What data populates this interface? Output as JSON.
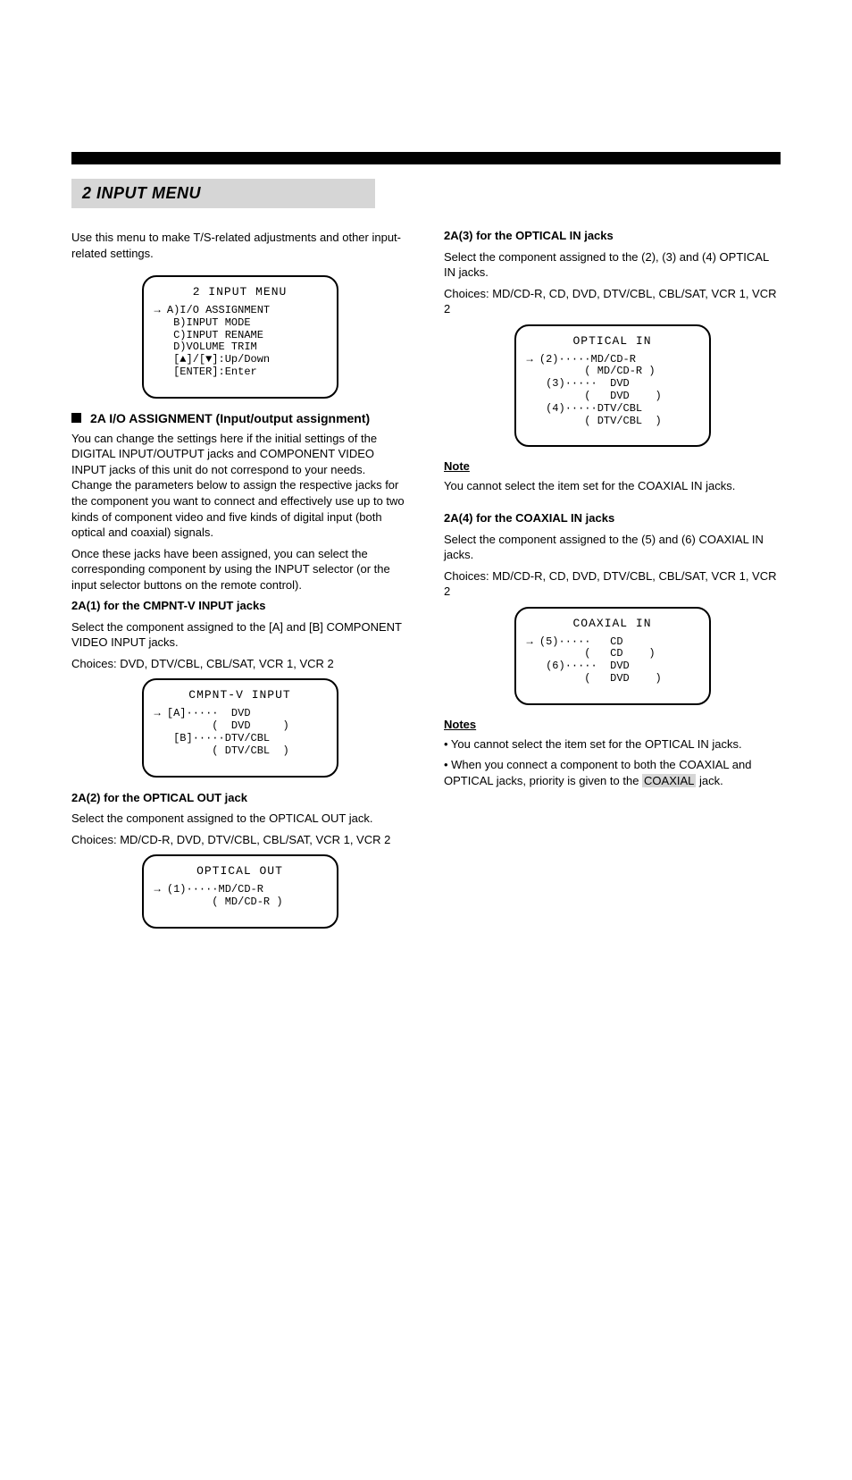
{
  "page": {
    "chapterTop": "",
    "sectionTitle": "2 INPUT MENU",
    "pagerLeft": "",
    "pagerRight": "",
    "leftColumn": {
      "intro": "Use this menu to make T/S-related adjustments and other input-related settings.",
      "osdInputMenu": {
        "title": "2 INPUT MENU",
        "lines": [
          "→ A)I/O ASSIGNMENT",
          "   B)INPUT MODE",
          "   C)INPUT RENAME",
          "   D)VOLUME TRIM",
          "   [▲]/[▼]:Up/Down",
          "   [ENTER]:Enter"
        ]
      },
      "heading1": "2A I/O ASSIGNMENT (Input/output assignment)",
      "p1": "You can change the settings here if the initial settings of the DIGITAL INPUT/OUTPUT jacks and COMPONENT VIDEO INPUT jacks of this unit do not correspond to your needs. Change the parameters below to assign the respective jacks for the component you want to connect and effectively use up to two kinds of component video and five kinds of digital input (both optical and coaxial) signals.",
      "p2": "Once these jacks have been assigned, you can select the corresponding component by using the INPUT selector (or the input selector buttons on the remote control).",
      "sub1": "2A(1) for the CMPNT-V INPUT jacks",
      "sub1desc": "Select the component assigned to the [A] and [B] COMPONENT VIDEO INPUT jacks.",
      "sub1choices": "Choices: DVD, DTV/CBL, CBL/SAT, VCR 1, VCR 2",
      "osdCmpnt": {
        "title": "CMPNT-V INPUT",
        "lines": [
          "→ [A]·····  DVD",
          "         (  DVD     )",
          "   [B]·····DTV/CBL",
          "         ( DTV/CBL  )"
        ]
      },
      "sub2": "2A(2) for the OPTICAL OUT jack",
      "sub2desc": "Select the component assigned to the OPTICAL OUT jack.",
      "sub2choices": "Choices: MD/CD-R, DVD, DTV/CBL, CBL/SAT, VCR 1, VCR 2",
      "osdOptOut": {
        "title": "OPTICAL OUT",
        "lines": [
          "→ (1)·····MD/CD-R",
          "         ( MD/CD-R )"
        ]
      }
    },
    "rightColumn": {
      "sub3": "2A(3) for the OPTICAL IN jacks",
      "sub3desc": "Select the component assigned to the (2), (3) and (4) OPTICAL IN jacks.",
      "sub3choices": "Choices: MD/CD-R, CD, DVD, DTV/CBL, CBL/SAT, VCR 1, VCR 2",
      "osdOptIn": {
        "title": "OPTICAL IN",
        "lines": [
          "→ (2)·····MD/CD-R",
          "         ( MD/CD-R )",
          "   (3)·····  DVD",
          "         (   DVD    )",
          "   (4)·····DTV/CBL",
          "         ( DTV/CBL  )"
        ]
      },
      "note1Label": "Note",
      "note1": "You cannot select the item set for the COAXIAL IN jacks.",
      "sub4": "2A(4) for the COAXIAL IN jacks",
      "sub4desc": "Select the component assigned to the (5) and (6) COAXIAL IN jacks.",
      "sub4choices": "Choices: MD/CD-R, CD, DVD, DTV/CBL, CBL/SAT, VCR 1, VCR 2",
      "osdCoax": {
        "title": "COAXIAL IN",
        "lines": [
          "→ (5)·····   CD",
          "         (   CD    )",
          "   (6)·····  DVD",
          "         (   DVD    )"
        ]
      },
      "notes2Label": "Notes",
      "notes2a": "• You cannot select the item set for the OPTICAL IN jacks.",
      "notes2b_pre": "• When you connect a component to both the COAXIAL and OPTICAL jacks, priority is given to the ",
      "notes2b_hl": "COAXIAL",
      "notes2b_post": " jack."
    }
  }
}
